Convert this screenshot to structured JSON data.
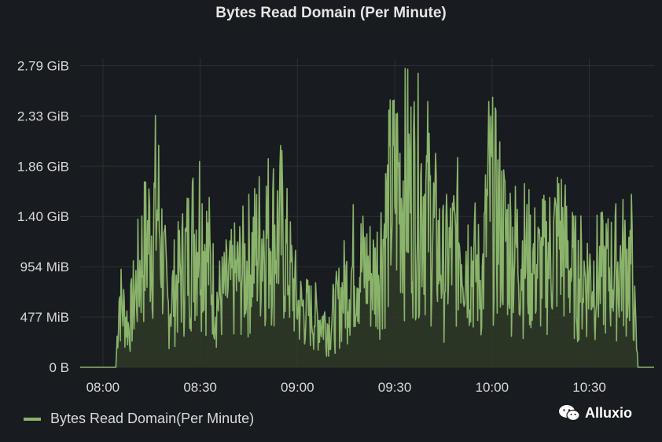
{
  "chart_data": {
    "type": "area",
    "title": "Bytes Read Domain (Per Minute)",
    "xlabel": "",
    "ylabel": "",
    "x_start": "07:53",
    "x_end": "10:50",
    "x_ticks": [
      "08:00",
      "08:30",
      "09:00",
      "09:30",
      "10:00",
      "10:30"
    ],
    "y_ticks": [
      "0 B",
      "477 MiB",
      "954 MiB",
      "1.40 GiB",
      "1.86 GiB",
      "2.33 GiB",
      "2.79 GiB"
    ],
    "ylim_mib": [
      0,
      2860
    ],
    "grid": true,
    "legend_position": "bottom-left",
    "series": [
      {
        "name": "Bytes Read Domain(Per Minute)",
        "color": "#8ab36b",
        "unit": "MiB",
        "approx_profile": [
          {
            "x": "07:53",
            "y": 0
          },
          {
            "x": "08:04",
            "y": 0
          },
          {
            "x": "08:05",
            "y": 1100
          },
          {
            "x": "08:08",
            "y": 600
          },
          {
            "x": "08:12",
            "y": 1700
          },
          {
            "x": "08:17",
            "y": 2450
          },
          {
            "x": "08:20",
            "y": 900
          },
          {
            "x": "08:30",
            "y": 2300
          },
          {
            "x": "08:35",
            "y": 1000
          },
          {
            "x": "08:45",
            "y": 1600
          },
          {
            "x": "08:50",
            "y": 2100
          },
          {
            "x": "08:55",
            "y": 2050
          },
          {
            "x": "09:00",
            "y": 950
          },
          {
            "x": "09:10",
            "y": 650
          },
          {
            "x": "09:18",
            "y": 1600
          },
          {
            "x": "09:24",
            "y": 1400
          },
          {
            "x": "09:30",
            "y": 2800
          },
          {
            "x": "09:32",
            "y": 2780
          },
          {
            "x": "09:39",
            "y": 2700
          },
          {
            "x": "09:45",
            "y": 1500
          },
          {
            "x": "09:50",
            "y": 2000
          },
          {
            "x": "09:57",
            "y": 1300
          },
          {
            "x": "09:59",
            "y": 2650
          },
          {
            "x": "10:05",
            "y": 1900
          },
          {
            "x": "10:15",
            "y": 1500
          },
          {
            "x": "10:21",
            "y": 2050
          },
          {
            "x": "10:25",
            "y": 1400
          },
          {
            "x": "10:32",
            "y": 1400
          },
          {
            "x": "10:43",
            "y": 1600
          },
          {
            "x": "10:45",
            "y": 0
          },
          {
            "x": "10:50",
            "y": 0
          }
        ]
      }
    ]
  },
  "watermark": {
    "text": "Alluxio",
    "icon": "wechat-icon"
  }
}
